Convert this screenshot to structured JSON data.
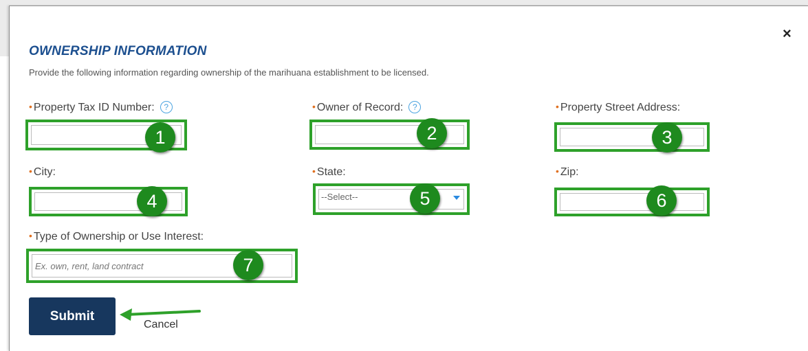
{
  "dialog": {
    "close_glyph": "×",
    "title": "OWNERSHIP INFORMATION",
    "description": "Provide the following information regarding ownership of the marihuana establishment to be licensed."
  },
  "fields": [
    {
      "label": "Property Tax ID Number:",
      "required": true,
      "help": true,
      "value": "",
      "badge": "1"
    },
    {
      "label": "Owner of Record:",
      "required": true,
      "help": true,
      "value": "",
      "badge": "2"
    },
    {
      "label": "Property Street Address:",
      "required": true,
      "help": false,
      "value": "",
      "badge": "3"
    },
    {
      "label": "City:",
      "required": true,
      "help": false,
      "value": "",
      "badge": "4"
    },
    {
      "label": "State:",
      "required": true,
      "help": false,
      "selected": "--Select--",
      "badge": "5"
    },
    {
      "label": "Zip:",
      "required": true,
      "help": false,
      "value": "",
      "badge": "6"
    },
    {
      "label": "Type of Ownership or Use Interest:",
      "required": true,
      "help": false,
      "placeholder": "Ex. own, rent, land contract",
      "badge": "7"
    }
  ],
  "required_marker": "•",
  "help_glyph": "?",
  "actions": {
    "submit_label": "Submit",
    "cancel_label": "Cancel"
  },
  "colors": {
    "title": "#1c4f8f",
    "required": "#e07020",
    "highlight": "#2ea12a",
    "badge": "#1e8a1e",
    "submit_bg": "#17375e",
    "help": "#4aa3e0"
  }
}
